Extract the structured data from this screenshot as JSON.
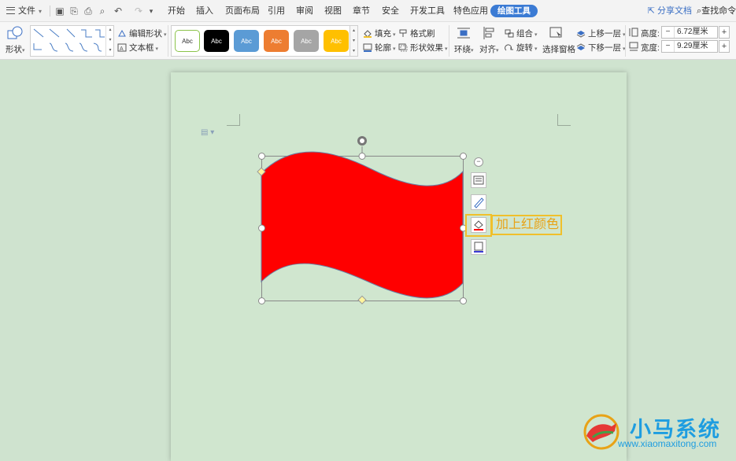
{
  "menubar": {
    "file_label": "文件",
    "tabs": [
      "开始",
      "插入",
      "页面布局",
      "引用",
      "审阅",
      "视图",
      "章节",
      "安全",
      "开发工具",
      "特色应用"
    ],
    "active_tab": "绘图工具",
    "share_label": "分享文档",
    "search_label": "查找命令"
  },
  "ribbon": {
    "shapes_label": "形状",
    "edit_shape_label": "编辑形状",
    "textbox_label": "文本框",
    "style_swatches": [
      {
        "label": "Abc",
        "bg": "#ffffff",
        "fg": "#333333",
        "border": "#8bc34a"
      },
      {
        "label": "Abc",
        "bg": "#000000",
        "fg": "#ffffff",
        "border": "#000000"
      },
      {
        "label": "Abc",
        "bg": "#5b9bd5",
        "fg": "#ffffff",
        "border": "#5b9bd5"
      },
      {
        "label": "Abc",
        "bg": "#ed7d31",
        "fg": "#ffffff",
        "border": "#ed7d31"
      },
      {
        "label": "Abc",
        "bg": "#a5a5a5",
        "fg": "#ffffff",
        "border": "#a5a5a5"
      },
      {
        "label": "Abc",
        "bg": "#ffc000",
        "fg": "#ffffff",
        "border": "#ffc000"
      }
    ],
    "fill_label": "填充",
    "format_painter_label": "格式刷",
    "outline_label": "轮廓",
    "shape_effects_label": "形状效果",
    "wrap_label": "环绕",
    "align_label": "对齐",
    "group_label": "组合",
    "rotate_label": "旋转",
    "selection_pane_label": "选择窗格",
    "bring_forward_label": "上移一层",
    "send_backward_label": "下移一层",
    "height_label": "高度:",
    "height_value": "6.72厘米",
    "width_label": "宽度:",
    "width_value": "9.29厘米"
  },
  "shape": {
    "fill_color": "#ff0000"
  },
  "annotation": {
    "text": "加上红颜色",
    "color": "#f0c02b"
  },
  "watermark": {
    "title": "小马系统",
    "url": "www.xiaomaxitong.com"
  }
}
